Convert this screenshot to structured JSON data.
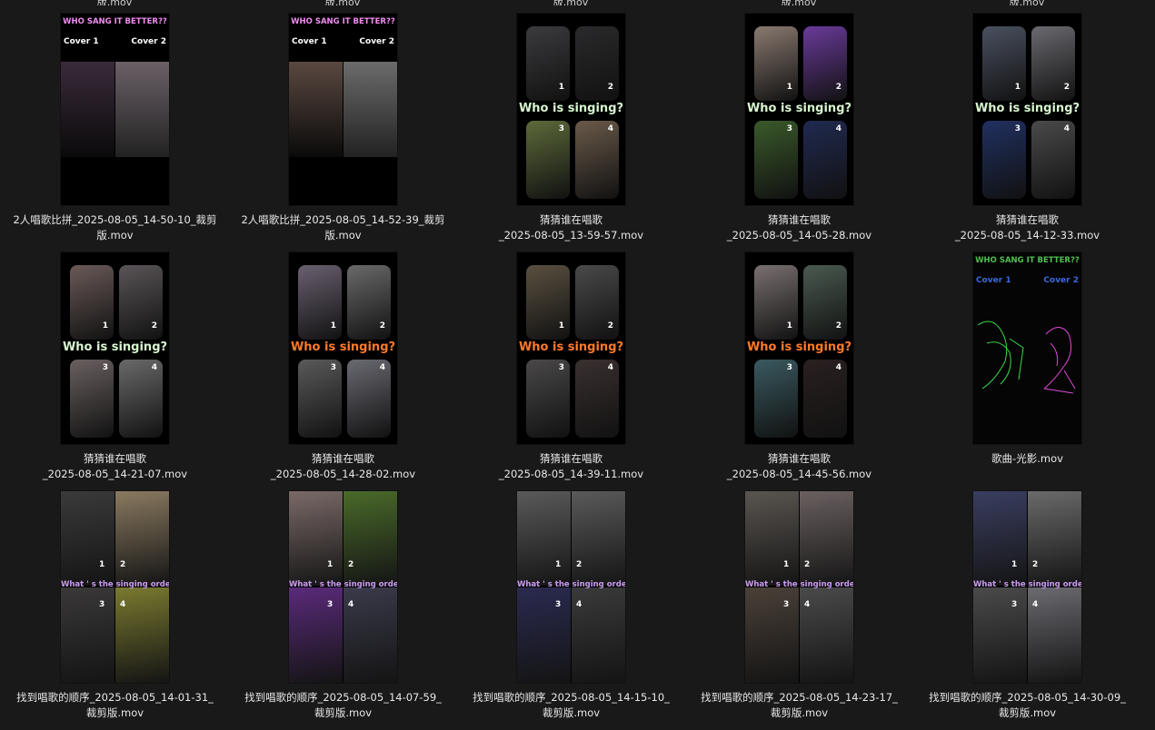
{
  "top_fragments": [
    "版.mov",
    "版.mov",
    "版.mov",
    "版.mov",
    "版.mov"
  ],
  "files": [
    {
      "line1": "2人唱歌比拼_2025-08-05_14-50-10_裁剪",
      "line2": "版.mov",
      "kind": "duo",
      "title": "WHO SANG IT BETTER??",
      "left": "Cover 1",
      "right": "Cover 2",
      "colors": [
        "#3a2a3a",
        "#6a6066"
      ]
    },
    {
      "line1": "2人唱歌比拼_2025-08-05_14-52-39_裁剪",
      "line2": "版.mov",
      "kind": "duo",
      "title": "WHO SANG IT BETTER??",
      "left": "Cover 1",
      "right": "Cover 2",
      "colors": [
        "#5a4840",
        "#6b6b6b"
      ]
    },
    {
      "line1": "猜猜谁在唱歌",
      "line2": "_2025-08-05_13-59-57.mov",
      "kind": "quad",
      "who": "Who is singing?",
      "whoColor": "#d8f5d0",
      "colors": [
        "#3b3b3e",
        "#2a2a2c",
        "#5d6a3a",
        "#6a5a4a"
      ]
    },
    {
      "line1": "猜猜谁在唱歌",
      "line2": "_2025-08-05_14-05-28.mov",
      "kind": "quad",
      "who": "Who is singing?",
      "whoColor": "#d8f5d0",
      "colors": [
        "#8a7a70",
        "#6a3a9a",
        "#3a5a2a",
        "#202a50"
      ]
    },
    {
      "line1": "猜猜谁在唱歌",
      "line2": "_2025-08-05_14-12-33.mov",
      "kind": "quad",
      "who": "Who is singing?",
      "whoColor": "#d8f5d0",
      "colors": [
        "#4a5060",
        "#6a6a70",
        "#203060",
        "#4a4a4a"
      ]
    },
    {
      "line1": "猜猜谁在唱歌",
      "line2": "_2025-08-05_14-21-07.mov",
      "kind": "quad",
      "who": "Who is singing?",
      "whoColor": "#d8f5d0",
      "colors": [
        "#6a5a58",
        "#5a5558",
        "#6a6060",
        "#6a6a6a"
      ]
    },
    {
      "line1": "猜猜谁在唱歌",
      "line2": "_2025-08-05_14-28-02.mov",
      "kind": "quad",
      "who": "Who is singing?",
      "whoColor": "#ff7a2a",
      "colors": [
        "#6a6070",
        "#6a6a6a",
        "#5a5a5a",
        "#6a6a72"
      ]
    },
    {
      "line1": "猜猜谁在唱歌",
      "line2": "_2025-08-05_14-39-11.mov",
      "kind": "quad",
      "who": "Who is singing?",
      "whoColor": "#ff7a2a",
      "colors": [
        "#5a5040",
        "#4a4a4a",
        "#4a4848",
        "#3a3030"
      ]
    },
    {
      "line1": "猜猜谁在唱歌",
      "line2": "_2025-08-05_14-45-56.mov",
      "kind": "quad",
      "who": "Who is singing?",
      "whoColor": "#ff7a2a",
      "colors": [
        "#7a7070",
        "#4a5a50",
        "#3a5a60",
        "#2a2020"
      ]
    },
    {
      "line1": "歌曲-光影.mov",
      "line2": "",
      "kind": "neon",
      "title": "WHO SANG IT BETTER??",
      "left": "Cover 1",
      "right": "Cover 2"
    },
    {
      "line1": "找到唱歌的顺序_2025-08-05_14-01-31_",
      "line2": "裁剪版.mov",
      "kind": "order",
      "who": "What ' s the singing order?",
      "colors": [
        "#3a3a3a",
        "#8a7a60",
        "#3a3838",
        "#7a7a30"
      ]
    },
    {
      "line1": "找到唱歌的顺序_2025-08-05_14-07-59_",
      "line2": "裁剪版.mov",
      "kind": "order",
      "who": "What ' s the singing order?",
      "colors": [
        "#7a6a68",
        "#4a6a2a",
        "#5a2a7a",
        "#3a3a4a"
      ]
    },
    {
      "line1": "找到唱歌的顺序_2025-08-05_14-15-10_",
      "line2": "裁剪版.mov",
      "kind": "order",
      "who": "What ' s the singing order?",
      "colors": [
        "#5a5a5a",
        "#5a5a5a",
        "#2a2a50",
        "#3a3a3a"
      ]
    },
    {
      "line1": "找到唱歌的顺序_2025-08-05_14-23-17_",
      "line2": "裁剪版.mov",
      "kind": "order",
      "who": "What ' s the singing order?",
      "colors": [
        "#5a5550",
        "#6a6060",
        "#4a4038",
        "#4a4a4a"
      ]
    },
    {
      "line1": "找到唱歌的顺序_2025-08-05_14-30-09_",
      "line2": "裁剪版.mov",
      "kind": "order",
      "who": "What ' s the singing order?",
      "colors": [
        "#3a3e60",
        "#6a6a6a",
        "#4a4a4a",
        "#6a6a70"
      ]
    }
  ]
}
